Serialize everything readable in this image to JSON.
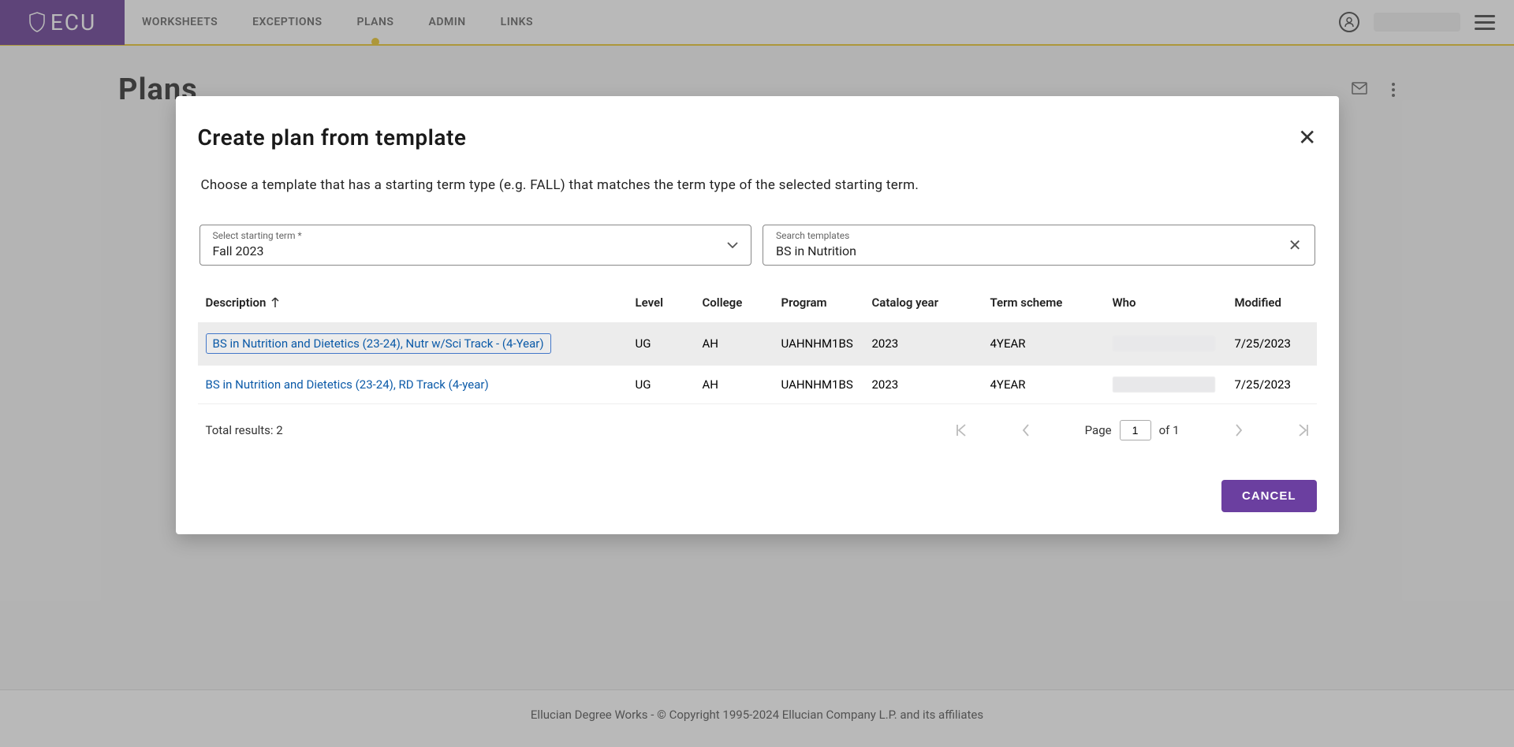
{
  "header": {
    "logo": "ECU",
    "nav": [
      "WORKSHEETS",
      "EXCEPTIONS",
      "PLANS",
      "ADMIN",
      "LINKS"
    ],
    "active_index": 2
  },
  "page": {
    "title": "Plans"
  },
  "modal": {
    "title": "Create plan from template",
    "instruction": "Choose a template that has a starting term type (e.g. FALL) that matches the term type of the selected starting term.",
    "starting_term_label": "Select starting term *",
    "starting_term_value": "Fall 2023",
    "search_label": "Search templates",
    "search_value": "BS in Nutrition",
    "columns": {
      "description": "Description",
      "level": "Level",
      "college": "College",
      "program": "Program",
      "catalog": "Catalog year",
      "scheme": "Term scheme",
      "who": "Who",
      "modified": "Modified"
    },
    "rows": [
      {
        "description": "BS in Nutrition and Dietetics (23-24), Nutr w/Sci Track - (4-Year)",
        "level": "UG",
        "college": "AH",
        "program": "UAHNHM1BS",
        "catalog": "2023",
        "scheme": "4YEAR",
        "who": "",
        "modified": "7/25/2023",
        "highlighted": true
      },
      {
        "description": "BS in Nutrition and Dietetics (23-24), RD Track (4-year)",
        "level": "UG",
        "college": "AH",
        "program": "UAHNHM1BS",
        "catalog": "2023",
        "scheme": "4YEAR",
        "who": "",
        "modified": "7/25/2023",
        "highlighted": false
      }
    ],
    "total_results": "Total results: 2",
    "page_label": "Page",
    "page_value": "1",
    "page_of": "of 1",
    "cancel_label": "CANCEL"
  },
  "footer": "Ellucian Degree Works - © Copyright 1995-2024 Ellucian Company L.P. and its affiliates"
}
